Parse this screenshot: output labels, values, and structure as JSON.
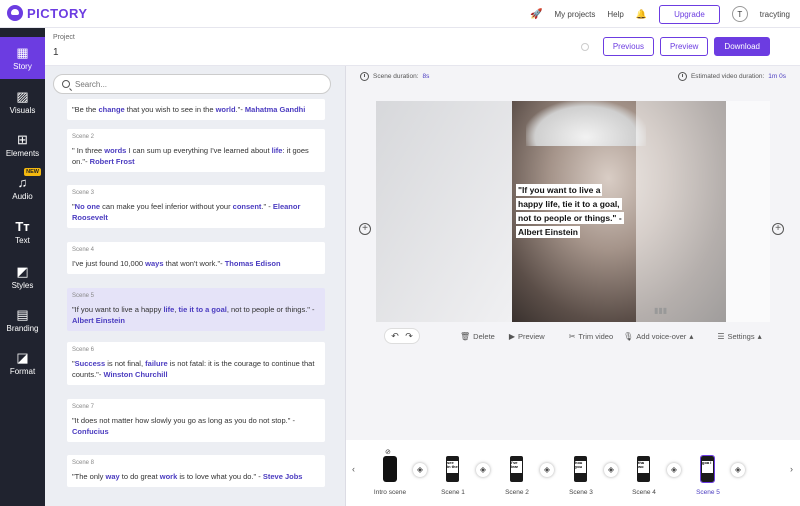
{
  "app": {
    "logo_text": "PICTORY",
    "accent": "#6c3ce1",
    "sidebar_bg": "#20232f"
  },
  "topbar": {
    "my_projects": "My projects",
    "help": "Help",
    "upgrade": "Upgrade",
    "avatar_initial": "T",
    "username": "tracyting"
  },
  "sidebar": {
    "items": [
      {
        "label": "Story",
        "icon": "story-icon",
        "active": true
      },
      {
        "label": "Visuals",
        "icon": "image-icon"
      },
      {
        "label": "Elements",
        "icon": "elements-icon"
      },
      {
        "label": "Audio",
        "icon": "music-icon",
        "badge": "NEW"
      },
      {
        "label": "Text",
        "icon": "text-icon"
      },
      {
        "label": "Styles",
        "icon": "styles-icon"
      },
      {
        "label": "Branding",
        "icon": "briefcase-icon"
      },
      {
        "label": "Format",
        "icon": "format-icon"
      }
    ]
  },
  "project": {
    "label": "Project",
    "name": "1",
    "previous": "Previous",
    "preview": "Preview",
    "download": "Download"
  },
  "search": {
    "placeholder": "Search..."
  },
  "scenes": [
    {
      "label": "",
      "parts": [
        [
          "\"Be the ",
          false
        ],
        [
          "change",
          true
        ],
        [
          " that you wish to see in the ",
          false
        ],
        [
          "world",
          true
        ],
        [
          ".\"- ",
          false
        ],
        [
          "Mahatma Gandhi",
          true
        ]
      ]
    },
    {
      "label": "Scene 2",
      "parts": [
        [
          "\" In three ",
          false
        ],
        [
          "words",
          true
        ],
        [
          " I can sum up everything I've learned about ",
          false
        ],
        [
          "life",
          true
        ],
        [
          ": it goes on.\"- ",
          false
        ],
        [
          "Robert Frost",
          true
        ]
      ]
    },
    {
      "label": "Scene 3",
      "parts": [
        [
          "\"",
          false
        ],
        [
          "No one",
          true
        ],
        [
          " can make you feel inferior without your ",
          false
        ],
        [
          "consent",
          true
        ],
        [
          ".\" - ",
          false
        ],
        [
          "Eleanor Roosevelt",
          true
        ]
      ]
    },
    {
      "label": "Scene 4",
      "parts": [
        [
          "I've just found 10,000 ",
          false
        ],
        [
          "ways",
          true
        ],
        [
          " that won't work.\"- ",
          false
        ],
        [
          "Thomas Edison",
          true
        ]
      ]
    },
    {
      "label": "Scene 5",
      "selected": true,
      "parts": [
        [
          "\"If you want to live a happy ",
          false
        ],
        [
          "life",
          true
        ],
        [
          ", ",
          false
        ],
        [
          "tie it to a goal",
          true
        ],
        [
          ", not to people or things.\" - ",
          false
        ],
        [
          "Albert Einstein",
          true
        ]
      ]
    },
    {
      "label": "Scene 6",
      "parts": [
        [
          "\"",
          false
        ],
        [
          "Success",
          true
        ],
        [
          " is not final, ",
          false
        ],
        [
          "failure",
          true
        ],
        [
          " is not fatal: it is the courage to continue that counts.\"- ",
          false
        ],
        [
          "Winston Churchill",
          true
        ]
      ]
    },
    {
      "label": "Scene 7",
      "parts": [
        [
          "\"It does not matter how slowly you go as long as you do not stop.\" - ",
          false
        ],
        [
          "Confucius",
          true
        ]
      ]
    },
    {
      "label": "Scene 8",
      "parts": [
        [
          "\"The only ",
          false
        ],
        [
          "way",
          true
        ],
        [
          " to do great ",
          false
        ],
        [
          "work",
          true
        ],
        [
          " is to love what you do.\" - ",
          false
        ],
        [
          "Steve Jobs",
          true
        ]
      ]
    }
  ],
  "editor": {
    "scene_duration_label": "Scene duration:",
    "scene_duration_value": "8s",
    "estimated_label": "Estimated video duration:",
    "estimated_value": "1m 0s",
    "quote_lines": [
      "\"If you want to live a",
      "happy life, tie it to a goal,",
      "not to people or things.\" -",
      "Albert Einstein"
    ],
    "toolbar": {
      "delete": "Delete",
      "preview": "Preview",
      "trim": "Trim video",
      "voice": "Add voice-over",
      "settings": "Settings"
    }
  },
  "timeline": {
    "items": [
      {
        "label": "Intro scene",
        "thumb_text": ""
      },
      {
        "label": "Scene 1",
        "thumb_text": "see in the"
      },
      {
        "label": "Scene 2",
        "thumb_text": "I've lear"
      },
      {
        "label": "Scene 3",
        "thumb_text": "hou you"
      },
      {
        "label": "Scene 4",
        "thumb_text": "tha wo"
      },
      {
        "label": "Scene 5",
        "thumb_text": "goa l",
        "selected": true
      }
    ]
  }
}
